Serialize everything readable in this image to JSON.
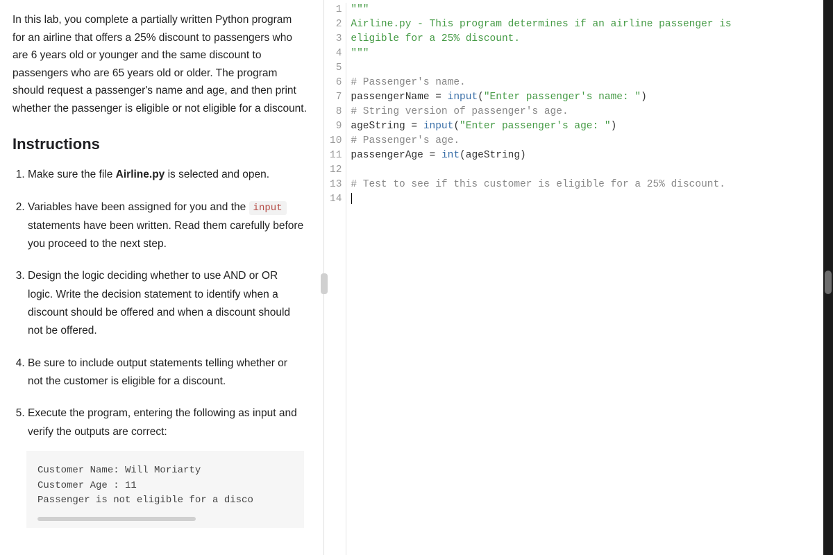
{
  "left": {
    "intro": "In this lab, you complete a partially written Python program for an airline that offers a 25% discount to passengers who are 6 years old or younger and the same discount to passengers who are 65 years old or older. The program should request a passenger's name and age, and then print whether the passenger is eligible or not eligible for a discount.",
    "instructions_heading": "Instructions",
    "step1_a": "Make sure the file ",
    "step1_file": "Airline.py",
    "step1_b": " is selected and open.",
    "step2_a": "Variables have been assigned for you and the ",
    "step2_code": "input",
    "step2_b": " statements have been written. Read them carefully before you proceed to the next step.",
    "step3": "Design the logic deciding whether to use AND or OR logic. Write the decision statement to identify when a discount should be offered and when a discount should not be offered.",
    "step4": "Be sure to include output statements telling whether or not the customer is eligible for a discount.",
    "step5": "Execute the program, entering the following as input and verify the outputs are correct:",
    "sample_l1": "Customer Name: Will Moriarty",
    "sample_l2": "Customer Age : 11",
    "sample_l3": "Passenger is not eligible for a disco"
  },
  "code": {
    "l1": {
      "s1": "\"\"\""
    },
    "l2": {
      "s1": "Airline.py - This program determines if an airline passenger is "
    },
    "l3": {
      "s1": "eligible for a 25% discount."
    },
    "l4": {
      "s1": "\"\"\""
    },
    "l5": {
      "s1": ""
    },
    "l6": {
      "c1": "# Passenger's name."
    },
    "l7": {
      "d1": "passengerName = ",
      "b1": "input",
      "d2": "(",
      "s1": "\"Enter passenger's name: \"",
      "d3": ")"
    },
    "l8": {
      "c1": "# String version of passenger's age."
    },
    "l9": {
      "d1": "ageString = ",
      "b1": "input",
      "d2": "(",
      "s1": "\"Enter passenger's age: \"",
      "d3": ")"
    },
    "l10": {
      "c1": "# Passenger's age."
    },
    "l11": {
      "d1": "passengerAge = ",
      "b1": "int",
      "d2": "(ageString)"
    },
    "l12": {
      "d1": ""
    },
    "l13": {
      "c1": "# Test to see if this customer is eligible for a 25% discount."
    },
    "l14": {
      "d1": ""
    }
  },
  "gutter": [
    "1",
    "2",
    "3",
    "4",
    "5",
    "6",
    "7",
    "8",
    "9",
    "10",
    "11",
    "12",
    "13",
    "14"
  ]
}
